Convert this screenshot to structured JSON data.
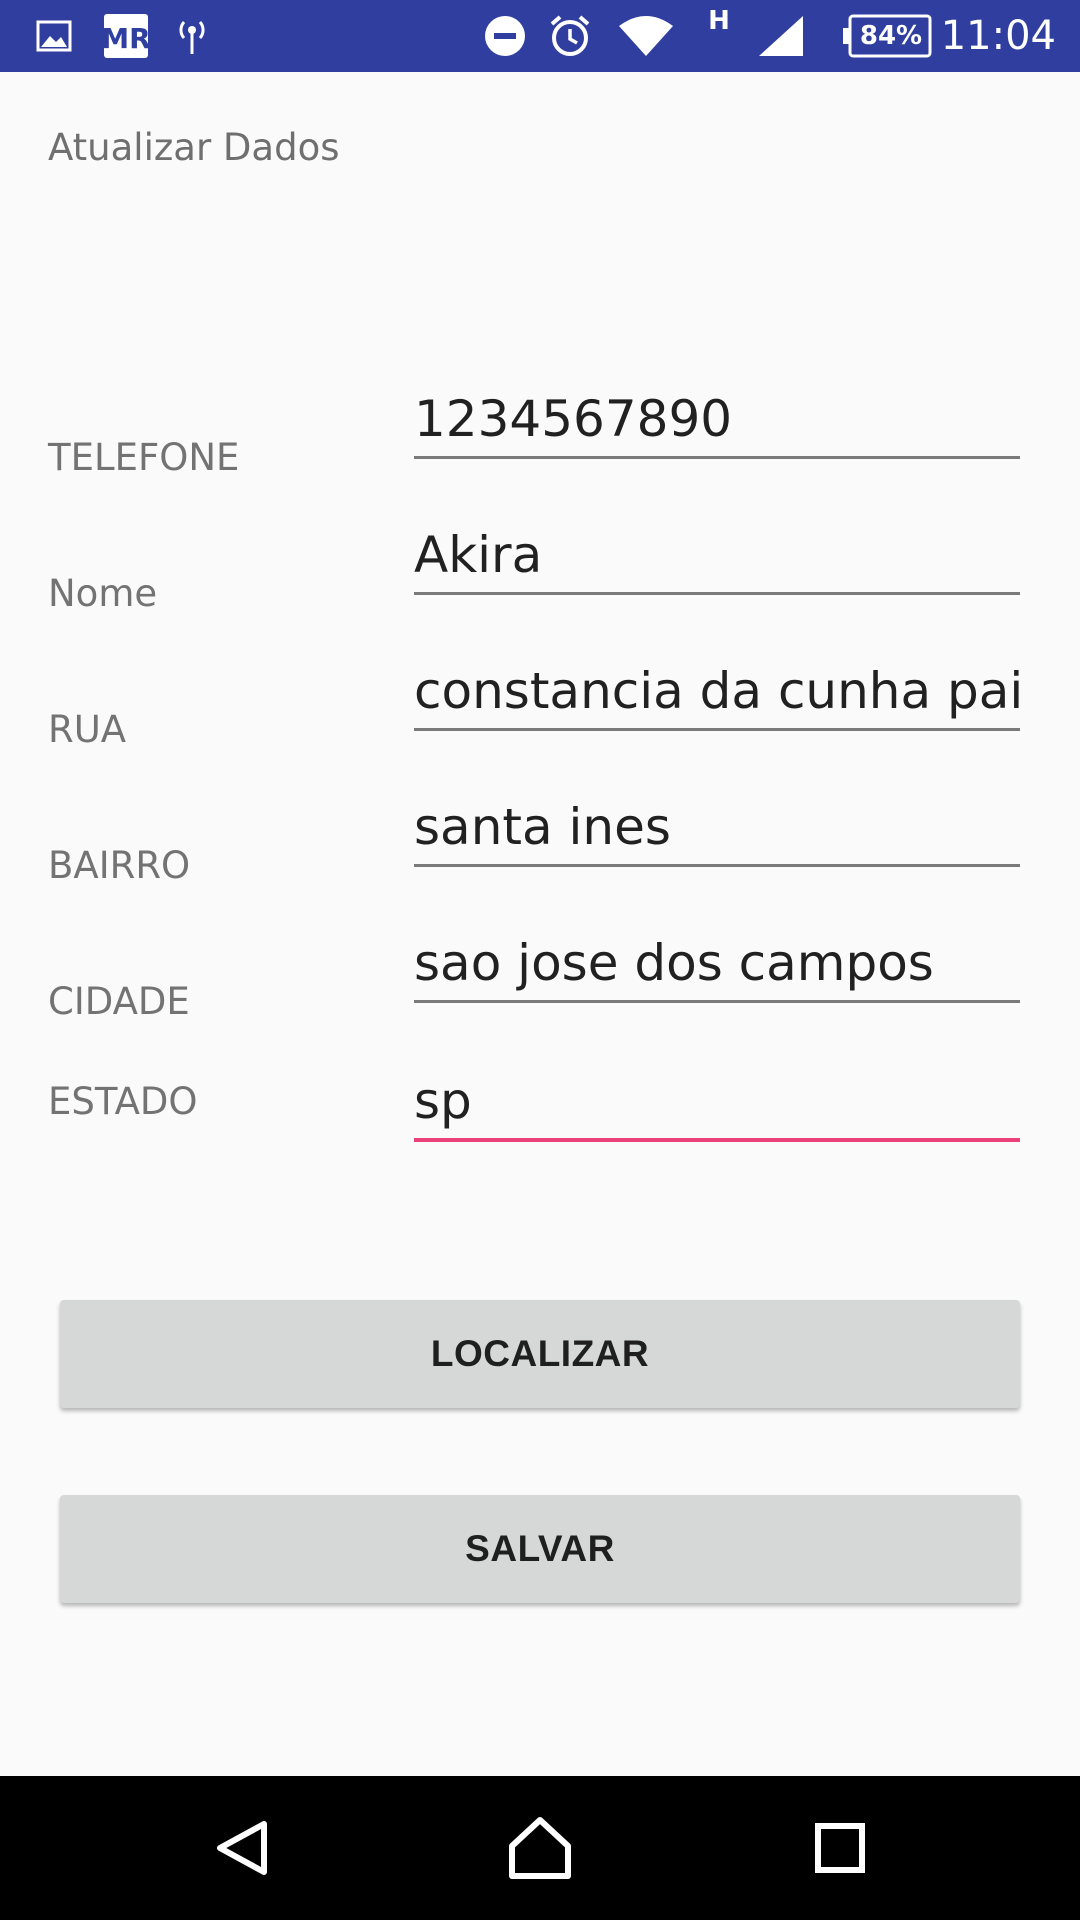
{
  "status_bar": {
    "time": "11:04",
    "battery": "84%",
    "network_type": "H",
    "colors": {
      "background": "#303f9f"
    },
    "icons": [
      "image-icon",
      "mr-app-icon",
      "hotspot-icon",
      "do-not-disturb-icon",
      "alarm-icon",
      "wifi-icon",
      "cell-signal-icon",
      "battery-icon"
    ]
  },
  "screen": {
    "title": "Atualizar Dados"
  },
  "form": {
    "fields": [
      {
        "label": "TELEFONE",
        "value": "1234567890"
      },
      {
        "label": "Nome",
        "value": "Akira"
      },
      {
        "label": "RUA",
        "value": "constancia da cunha paiv"
      },
      {
        "label": "BAIRRO",
        "value": "santa ines"
      },
      {
        "label": "CIDADE",
        "value": "sao jose dos campos"
      },
      {
        "label": "ESTADO",
        "value": "sp"
      }
    ],
    "focused_field": "ESTADO",
    "colors": {
      "focus_underline": "#ec407a",
      "underline": "#7a7a7a"
    }
  },
  "buttons": {
    "localizar": "LOCALIZAR",
    "salvar": "SALVAR"
  },
  "nav_bar": {
    "icons": [
      "back-icon",
      "home-icon",
      "recents-icon"
    ]
  }
}
